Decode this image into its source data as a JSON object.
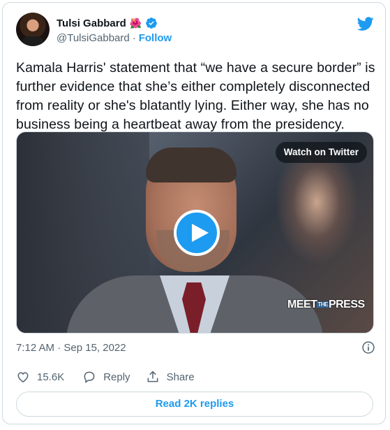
{
  "author": {
    "name": "Tulsi Gabbard",
    "handle": "@TulsiGabbard",
    "separator": "·",
    "follow_label": "Follow"
  },
  "tweet": {
    "text": "Kamala Harris' statement that “we have a secure border” is further evidence that she’s either completely disconnected from reality or she's blatantly lying. Either way, she has no business being a heartbeat away from the presidency."
  },
  "media": {
    "watch_label": "Watch on Twitter",
    "watermark_left": "MEET",
    "watermark_mid": "THE",
    "watermark_right": "PRESS"
  },
  "meta": {
    "timestamp": "7:12 AM · Sep 15, 2022"
  },
  "actions": {
    "likes": "15.6K",
    "reply_label": "Reply",
    "share_label": "Share"
  },
  "read_replies_label": "Read 2K replies",
  "colors": {
    "accent": "#1d9bf0",
    "text": "#0f1419",
    "muted": "#536471",
    "border": "#cfd9de"
  },
  "icons": [
    "verified-badge-icon",
    "hibiscus-emoji-icon",
    "twitter-bird-icon",
    "play-icon",
    "info-icon",
    "heart-icon",
    "reply-bubble-icon",
    "share-icon"
  ]
}
